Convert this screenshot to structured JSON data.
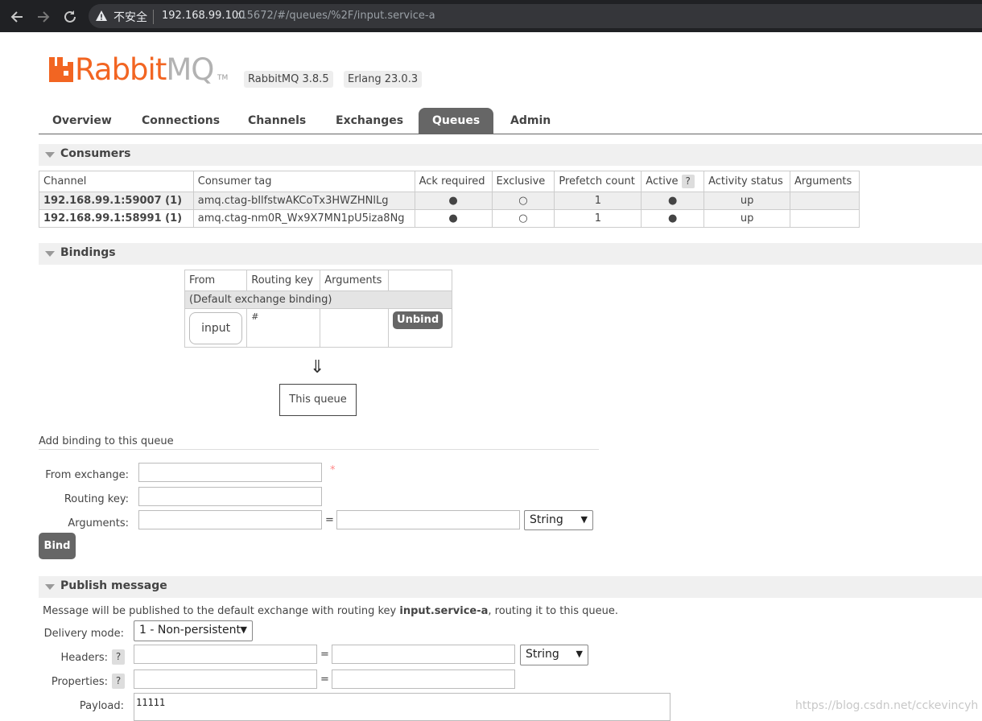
{
  "browser": {
    "security_label": "不安全",
    "url_host": "192.168.99.100",
    "url_rest": ":15672/#/queues/%2F/input.service-a"
  },
  "header": {
    "logo_rabbit": "Rabbit",
    "logo_mq": "MQ",
    "logo_tm": "TM",
    "version": "RabbitMQ 3.8.5",
    "erlang": "Erlang 23.0.3",
    "brand_color": "#f26522"
  },
  "tabs": [
    "Overview",
    "Connections",
    "Channels",
    "Exchanges",
    "Queues",
    "Admin"
  ],
  "active_tab": "Queues",
  "consumers": {
    "title": "Consumers",
    "columns": [
      "Channel",
      "Consumer tag",
      "Ack required",
      "Exclusive",
      "Prefetch count",
      "Active",
      "Activity status",
      "Arguments"
    ],
    "active_help": "?",
    "rows": [
      {
        "channel": "192.168.99.1:59007 (1)",
        "tag": "amq.ctag-bIlfstwAKCoTx3HWZHNlLg",
        "ack": "●",
        "exclusive": "○",
        "prefetch": "1",
        "active": "●",
        "status": "up",
        "arguments": ""
      },
      {
        "channel": "192.168.99.1:58991 (1)",
        "tag": "amq.ctag-nm0R_Wx9X7MN1pU5iza8Ng",
        "ack": "●",
        "exclusive": "○",
        "prefetch": "1",
        "active": "●",
        "status": "up",
        "arguments": ""
      }
    ]
  },
  "bindings": {
    "title": "Bindings",
    "columns": [
      "From",
      "Routing key",
      "Arguments",
      ""
    ],
    "default_binding": "(Default exchange binding)",
    "row": {
      "from": "input",
      "routing_key": "#",
      "arguments": "",
      "action": "Unbind"
    },
    "arrow": "⇓",
    "this_queue": "This queue"
  },
  "add_binding": {
    "title": "Add binding to this queue",
    "from_exchange_label": "From exchange:",
    "routing_key_label": "Routing key:",
    "arguments_label": "Arguments:",
    "required_mark": "*",
    "equals": "=",
    "type_value": "String",
    "bind_label": "Bind"
  },
  "publish": {
    "title": "Publish message",
    "info_prefix": "Message will be published to the default exchange with routing key ",
    "routing_key": "input.service-a",
    "info_suffix": ", routing it to this queue.",
    "delivery_mode_label": "Delivery mode:",
    "delivery_mode_value": "1 - Non-persistent",
    "headers_label": "Headers:",
    "properties_label": "Properties:",
    "help": "?",
    "equals": "=",
    "header_type_value": "String",
    "payload_label": "Payload:",
    "payload_value": "11111"
  },
  "watermark": "https://blog.csdn.net/cckevincyh"
}
